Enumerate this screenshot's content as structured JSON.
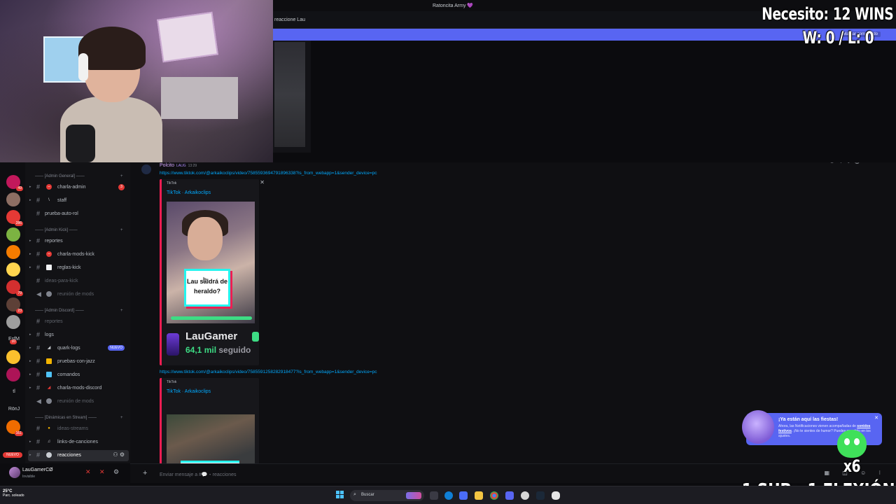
{
  "window": {
    "title": "Ratoncita Army 💜"
  },
  "channel_header": {
    "name": "reaccione Lau",
    "mini_button": "Marcar como leído"
  },
  "overlays": {
    "wins_needed": "Necesito: 12 WINS",
    "win_loss": "W: 0 / L: 0",
    "sub_rule": "1 SUB : 1 FLEXIÓN",
    "multiplier": "x6"
  },
  "servers": [
    {
      "label": "",
      "badge": "49"
    },
    {
      "label": "",
      "badge": ""
    },
    {
      "label": "",
      "badge": "286"
    },
    {
      "label": "",
      "badge": ""
    },
    {
      "label": "",
      "badge": ""
    },
    {
      "label": "",
      "badge": ""
    },
    {
      "label": "",
      "badge": "79"
    },
    {
      "label": "",
      "badge": "23"
    },
    {
      "label": "",
      "badge": ""
    },
    {
      "label": "EsfM",
      "badge": "10"
    },
    {
      "label": "",
      "badge": ""
    },
    {
      "label": "",
      "badge": ""
    },
    {
      "label": "tl",
      "badge": ""
    },
    {
      "label": "RönJ",
      "badge": ""
    },
    {
      "label": "",
      "badge": "161"
    }
  ],
  "rail_new_badge": "NUEVO",
  "sidebar": {
    "categories": {
      "admin_general": "[Admin General]",
      "admin_kick": "[Admin Kick]",
      "admin_discord": "[Admin Discord]",
      "dinamicas": "[Dinámicas en Stream]"
    },
    "channels": {
      "charla_admin": {
        "label": "charla-admin",
        "count": "3"
      },
      "staff": {
        "label": "staff"
      },
      "prueba_auto_rol": {
        "label": "prueba-auto-rol"
      },
      "reportes_kick": {
        "label": "reportes"
      },
      "charla_mods_kick": {
        "label": "charla-mods-kick"
      },
      "reglas_kick": {
        "label": "reglas-kick"
      },
      "ideas_para_kick": {
        "label": "ideas-para-kick"
      },
      "reunion_mods_1": {
        "label": "reunión de mods"
      },
      "reportes_discord": {
        "label": "reportes"
      },
      "logs": {
        "label": "logs"
      },
      "quark_logs": {
        "label": "quark-logs",
        "badge": "NUEVO"
      },
      "pruebas_con_jazz": {
        "label": "pruebas-con-jazz"
      },
      "comandos": {
        "label": "comandos"
      },
      "charla_mods_discord": {
        "label": "charla-mods-discord"
      },
      "reunion_mods_2": {
        "label": "reunión de mods"
      },
      "ideas_streams": {
        "label": "ideas-streams"
      },
      "links_de_canciones": {
        "label": "links-de-canciones"
      },
      "reacciones": {
        "label": "reacciones"
      }
    }
  },
  "user_panel": {
    "name": "LauGamerCØ",
    "status": "Invisible"
  },
  "message": {
    "author": "Polcito",
    "tag": "LAUG",
    "time": "13:29",
    "link1": "https://www.tiktok.com/@arkaikoclips/video/7585593694791896338?is_from_webapp=1&sender_device=pc",
    "link2": "https://www.tiktok.com/@arkaikoclips/video/7585591258282918477?is_from_webapp=1&sender_device=pc",
    "embed1": {
      "provider": "TikTok",
      "title": "TikTok · Arkaikoclips",
      "caption": "Lau saldrá de heraldo?",
      "profile_name": "LauGamer",
      "followers": "64,1 mil",
      "followers_suffix": "seguido"
    },
    "embed2": {
      "provider": "TikTok",
      "title": "TikTok · Arkaikoclips"
    }
  },
  "notification": {
    "title": "¡Ya están aquí las fiestas!",
    "body_pre": "Ahora, las Notificaciones vienen acompañadas de ",
    "body_link": "sonidos festivos",
    "body_post": ". ¡No te sientes de humor? Puedes revertirlo en los ajustes."
  },
  "composer": {
    "placeholder": "Enviar mensaje a #💬・reacciones"
  },
  "taskbar": {
    "temp": "25°C",
    "weather": "Parc. soleado",
    "search": "Buscar"
  },
  "colors": {
    "accent": "#5865f2",
    "link": "#00a8fc",
    "tiktok_red": "#ee1d52",
    "tiktok_cyan": "#25f4ee",
    "follow_green": "#3ddc84"
  }
}
